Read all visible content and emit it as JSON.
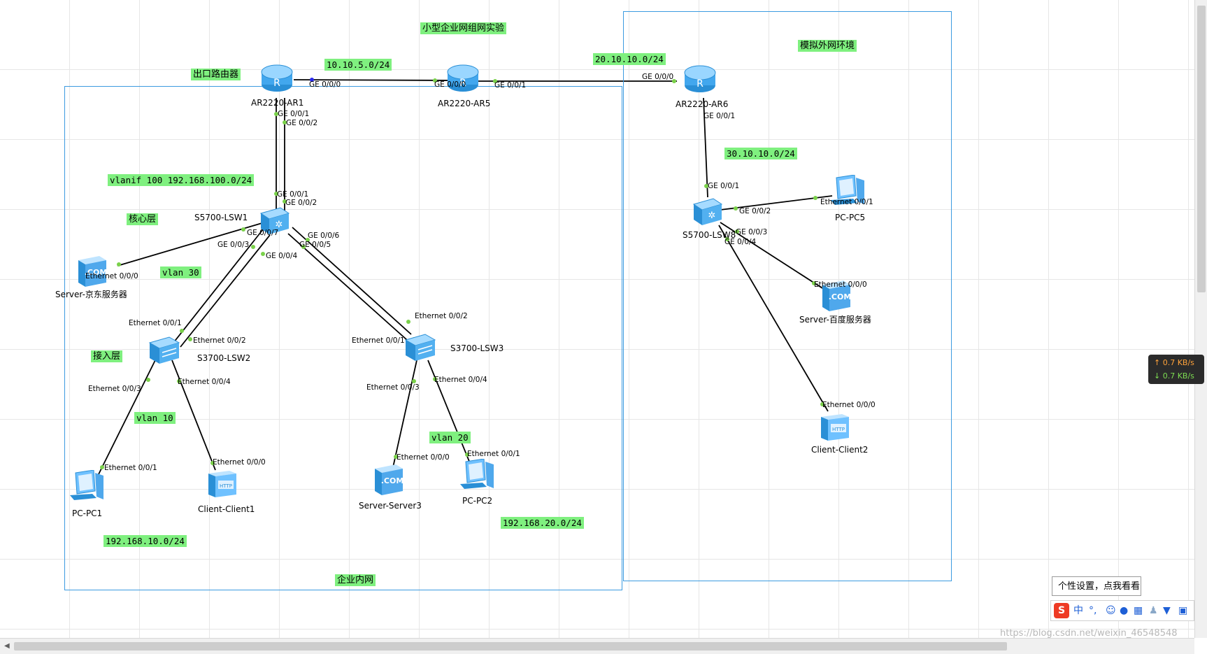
{
  "title": "小型企业网组网实验",
  "areas": {
    "intranet": "企业内网",
    "external": "模拟外网环境"
  },
  "notes": {
    "egress_router": "出口路由器",
    "net_ar1_ar5": "10.10.5.0/24",
    "net_ar5_ar6": "20.10.10.0/24",
    "vlanif": "vlanif 100 192.168.100.0/24",
    "core_layer": "核心层",
    "vlan30": "vlan 30",
    "access_layer": "接入层",
    "vlan10": "vlan 10",
    "vlan20": "vlan 20",
    "net_vlan10": "192.168.10.0/24",
    "net_vlan20": "192.168.20.0/24",
    "net_external": "30.10.10.0/24"
  },
  "devices": {
    "ar1": "AR2220-AR1",
    "ar5": "AR2220-AR5",
    "ar6": "AR2220-AR6",
    "lsw1": "S5700-LSW1",
    "lsw2": "S3700-LSW2",
    "lsw3": "S3700-LSW3",
    "lsw8": "S5700-LSW8",
    "jd_server": "Server-京东服务器",
    "pc1": "PC-PC1",
    "client1": "Client-Client1",
    "server3": "Server-Server3",
    "pc2": "PC-PC2",
    "pc5": "PC-PC5",
    "baidu_server": "Server-百度服务器",
    "client2": "Client-Client2"
  },
  "ports": {
    "ar1_ge000": "GE 0/0/0",
    "ar1_ge001": "GE 0/0/1",
    "ar1_ge002": "GE 0/0/2",
    "ar5_ge000": "GE 0/0/0",
    "ar5_ge001": "GE 0/0/1",
    "ar6_ge000": "GE 0/0/0",
    "ar6_ge001": "GE 0/0/1",
    "lsw1_ge001": "GE 0/0/1",
    "lsw1_ge002": "GE 0/0/2",
    "lsw1_ge007": "GE 0/0/7",
    "lsw1_ge003": "GE 0/0/3",
    "lsw1_ge004": "GE 0/0/4",
    "lsw1_ge006": "GE 0/0/6",
    "lsw1_ge005": "GE 0/0/5",
    "jd_eth000": "Ethernet 0/0/0",
    "lsw2_eth001": "Ethernet 0/0/1",
    "lsw2_eth002": "Ethernet 0/0/2",
    "lsw2_eth003": "Ethernet 0/0/3",
    "lsw2_eth004": "Ethernet 0/0/4",
    "pc1_eth001": "Ethernet 0/0/1",
    "client1_eth000": "Ethernet 0/0/0",
    "lsw3_eth002": "Ethernet 0/0/2",
    "lsw3_eth001": "Ethernet 0/0/1",
    "lsw3_eth003": "Ethernet 0/0/3",
    "lsw3_eth004": "Ethernet 0/0/4",
    "server3_eth000": "Ethernet 0/0/0",
    "pc2_eth001": "Ethernet 0/0/1",
    "lsw8_ge001": "GE 0/0/1",
    "lsw8_ge002": "GE 0/0/2",
    "lsw8_ge003": "GE 0/0/3",
    "lsw8_ge004": "GE 0/0/4",
    "pc5_eth001": "Ethernet 0/0/1",
    "baidu_eth000": "Ethernet 0/0/0",
    "client2_eth000": "Ethernet 0/0/0"
  },
  "icons": {
    "router": "router-icon",
    "core_switch": "layer3-switch-icon",
    "access_switch": "layer2-switch-icon",
    "server": "server-icon",
    "pc": "pc-icon",
    "client": "client-icon"
  },
  "colors": {
    "link": "#000000",
    "port_dot": "#7ad14a",
    "area_border": "#3c9be0",
    "note_bg": "#7ff07f",
    "grid": "#e6e6e6"
  },
  "netspeed": {
    "up": "↑ 0.7 KB/s",
    "down": "↓ 0.7 KB/s"
  },
  "tooltip": "个性设置，点我看看",
  "ime": {
    "logo": "S",
    "mode": "中",
    "punct": "°,"
  },
  "watermark": "https://blog.csdn.net/weixin_46548548"
}
